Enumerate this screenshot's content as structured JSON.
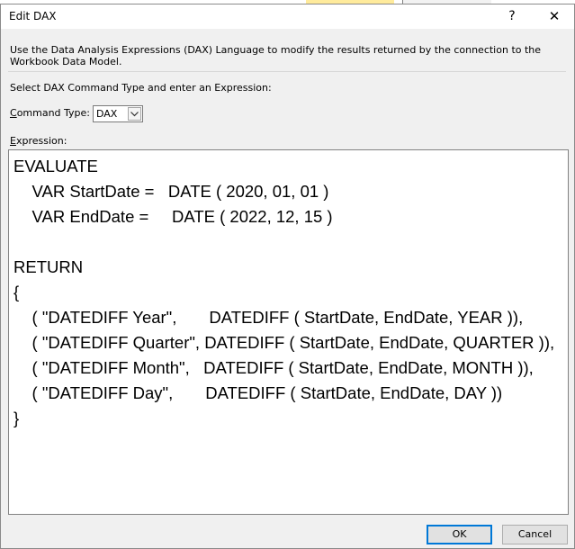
{
  "window": {
    "title": "Edit DAX",
    "help_label": "?",
    "close_label": "✕"
  },
  "description": "Use the Data Analysis Expressions (DAX) Language to modify the results returned by the connection to the Workbook Data Model.",
  "select_label": "Select DAX Command Type and enter an Expression:",
  "command_type": {
    "label_accel": "C",
    "label_rest": "ommand Type:",
    "value": "DAX"
  },
  "expression": {
    "label_accel": "E",
    "label_rest": "xpression:",
    "lines": [
      "EVALUATE",
      "    VAR StartDate =   DATE ( 2020, 01, 01 )",
      "    VAR EndDate =     DATE ( 2022, 12, 15 )",
      "",
      "RETURN",
      "{",
      "    ( \"DATEDIFF Year\",       DATEDIFF ( StartDate, EndDate, YEAR )),",
      "    ( \"DATEDIFF Quarter\", DATEDIFF ( StartDate, EndDate, QUARTER )),",
      "    ( \"DATEDIFF Month\",   DATEDIFF ( StartDate, EndDate, MONTH )),",
      "    ( \"DATEDIFF Day\",       DATEDIFF ( StartDate, EndDate, DAY ))",
      "}"
    ]
  },
  "buttons": {
    "ok": "OK",
    "cancel": "Cancel"
  },
  "colors": {
    "dialog_bg": "#f0f0f0",
    "ok_border": "#0078d7",
    "editor_bg": "#ffffff"
  }
}
